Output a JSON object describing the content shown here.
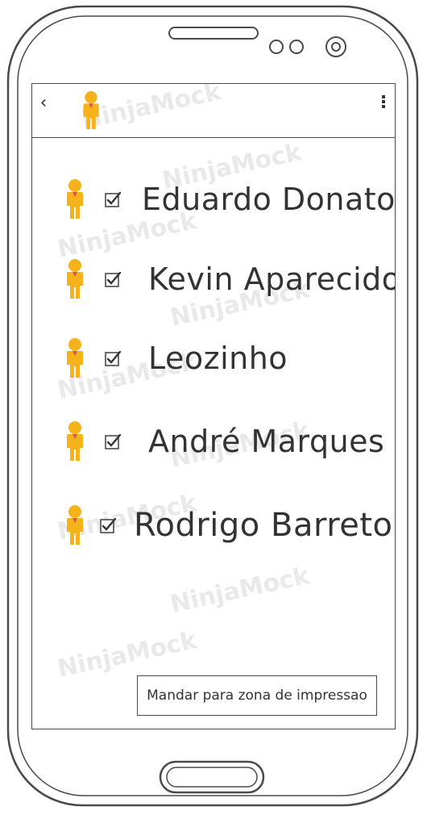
{
  "app": {
    "back_icon": "chevron-left-icon",
    "menu_icon": "more-vertical-icon",
    "user_icon": "person-icon"
  },
  "contacts": [
    {
      "name": "Eduardo Donato",
      "checked": true
    },
    {
      "name": "Kevin Aparecido",
      "checked": true
    },
    {
      "name": "Leozinho",
      "checked": true
    },
    {
      "name": "André Marques",
      "checked": true
    },
    {
      "name": "Rodrigo Barreto",
      "checked": true
    }
  ],
  "print_button": {
    "label": "Mandar para zona de impressao"
  },
  "watermark": {
    "text": "NinjaMock"
  },
  "colors": {
    "avatar": "#f5b21b",
    "tie": "#d9534f",
    "stroke": "#4a4a4a",
    "watermark": "#e9e9e9"
  }
}
